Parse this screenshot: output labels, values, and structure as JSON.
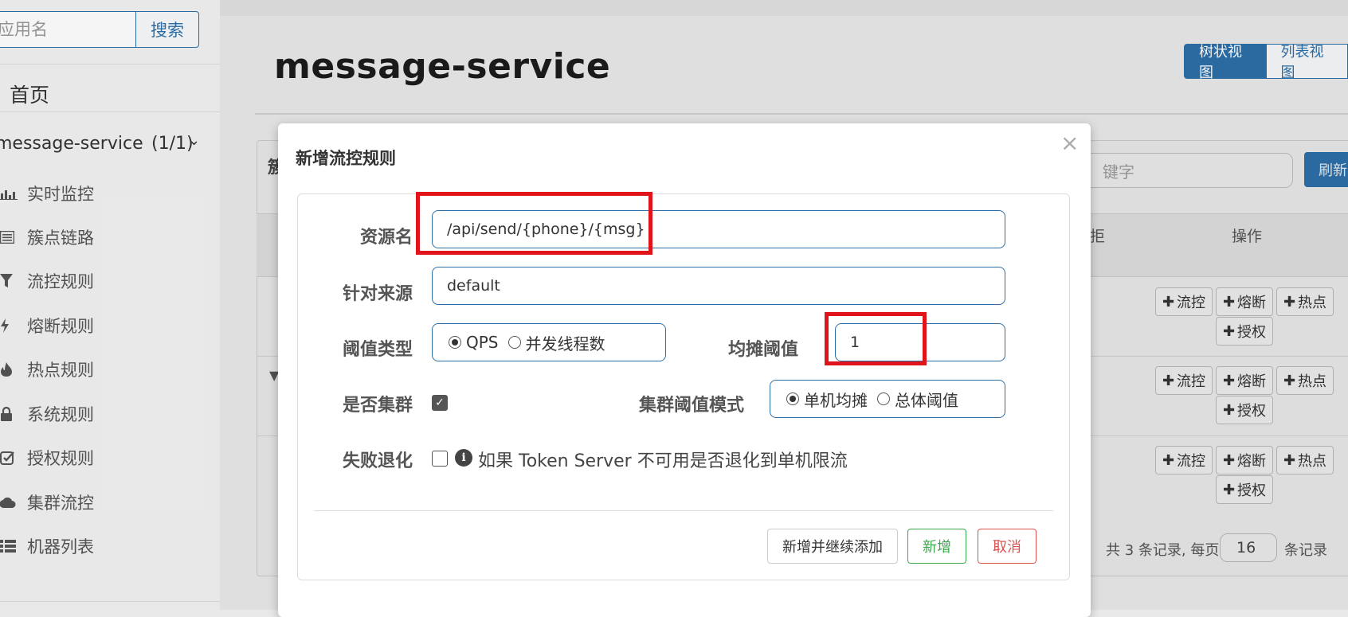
{
  "sidebar": {
    "search_placeholder": "应用名",
    "search_button": "搜索",
    "home": "首页",
    "app_name": "message-service",
    "app_count": "(1/1)",
    "menu": [
      {
        "label": "实时监控",
        "icon": "bar-chart-icon"
      },
      {
        "label": "簇点链路",
        "icon": "list-icon"
      },
      {
        "label": "流控规则",
        "icon": "filter-icon"
      },
      {
        "label": "熔断规则",
        "icon": "bolt-icon"
      },
      {
        "label": "热点规则",
        "icon": "fire-icon"
      },
      {
        "label": "系统规则",
        "icon": "lock-icon"
      },
      {
        "label": "授权规则",
        "icon": "check-square-icon"
      },
      {
        "label": "集群流控",
        "icon": "cloud-icon"
      },
      {
        "label": "机器列表",
        "icon": "th-list-icon"
      }
    ]
  },
  "main": {
    "title": "message-service",
    "view_tree": "树状视图",
    "view_list": "列表视图",
    "panel_head_partial": "簇",
    "keyword_placeholder": "键字",
    "refresh": "刷新",
    "col_reject": "拒",
    "col_ops": "操作",
    "op_flow": "流控",
    "op_degrade": "熔断",
    "op_hot": "热点",
    "op_auth": "授权",
    "pager_prefix": "共 3 条记录, 每页",
    "page_size": "16",
    "pager_suffix": "条记录"
  },
  "modal": {
    "title": "新增流控规则",
    "close": "×",
    "resource_label": "资源名",
    "resource_value": "/api/send/{phone}/{msg}",
    "origin_label": "针对来源",
    "origin_value": "default",
    "threshold_type_label": "阈值类型",
    "threshold_type_options": [
      "QPS",
      "并发线程数"
    ],
    "threshold_type_selected": "QPS",
    "avg_threshold_label": "均摊阈值",
    "avg_threshold_value": "1",
    "cluster_label": "是否集群",
    "cluster_checked": true,
    "cluster_mode_label": "集群阈值模式",
    "cluster_mode_options": [
      "单机均摊",
      "总体阈值"
    ],
    "cluster_mode_selected": "单机均摊",
    "fallback_label": "失败退化",
    "fallback_checked": false,
    "fallback_hint": "如果 Token Server 不可用是否退化到单机限流",
    "btn_add_continue": "新增并继续添加",
    "btn_add": "新增",
    "btn_cancel": "取消"
  },
  "colors": {
    "primary": "#2c6fa8",
    "success": "#3aa84c",
    "danger": "#d9534f",
    "highlight": "#e0141b"
  }
}
